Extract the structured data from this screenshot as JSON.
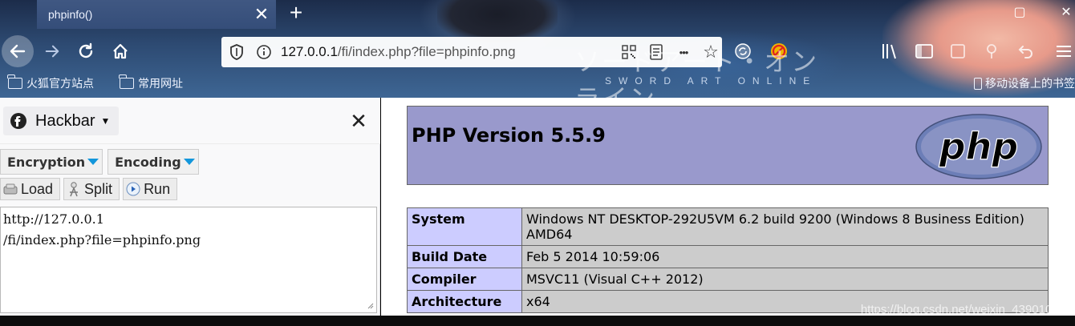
{
  "browser": {
    "tab": {
      "title": "phpinfo()",
      "close": "✕"
    },
    "new_tab": "+",
    "window": {
      "restore": "▢",
      "close": "✕"
    },
    "url": {
      "host": "127.0.0.1",
      "path": "/fi/index.php?file=phpinfo.png"
    },
    "url_icons": {
      "more": "•••",
      "star": "☆"
    },
    "theme": {
      "jp_title": "ソードアート・オンライン",
      "en_title": "SWORD ART ONLINE"
    },
    "bookmarks": [
      {
        "label": "火狐官方站点"
      },
      {
        "label": "常用网址"
      }
    ],
    "mobile_bookmarks": "移动设备上的书签"
  },
  "hackbar": {
    "title": "Hackbar",
    "close": "✕",
    "menus": [
      {
        "label": "Encryption"
      },
      {
        "label": "Encoding"
      }
    ],
    "buttons": [
      {
        "label": "Load"
      },
      {
        "label": "Split"
      },
      {
        "label": "Run"
      }
    ],
    "textarea_value": "http://127.0.0.1\n/fi/index.php?file=phpinfo.png"
  },
  "phpinfo": {
    "title": "PHP Version 5.5.9",
    "logo_text": "php",
    "rows": [
      {
        "key": "System",
        "value": "Windows NT DESKTOP-292U5VM 6.2 build 9200 (Windows 8 Business Edition) AMD64"
      },
      {
        "key": "Build Date",
        "value": "Feb 5 2014 10:59:06"
      },
      {
        "key": "Compiler",
        "value": "MSVC11 (Visual C++ 2012)"
      },
      {
        "key": "Architecture",
        "value": "x64"
      }
    ]
  },
  "watermark": "https://blog.csdn.net/weixin_43901038",
  "colors": {
    "php_header": "#9999cc",
    "php_key_cell": "#ccccff",
    "php_value_cell": "#cccccc",
    "hackbar_accent": "#1296db"
  }
}
